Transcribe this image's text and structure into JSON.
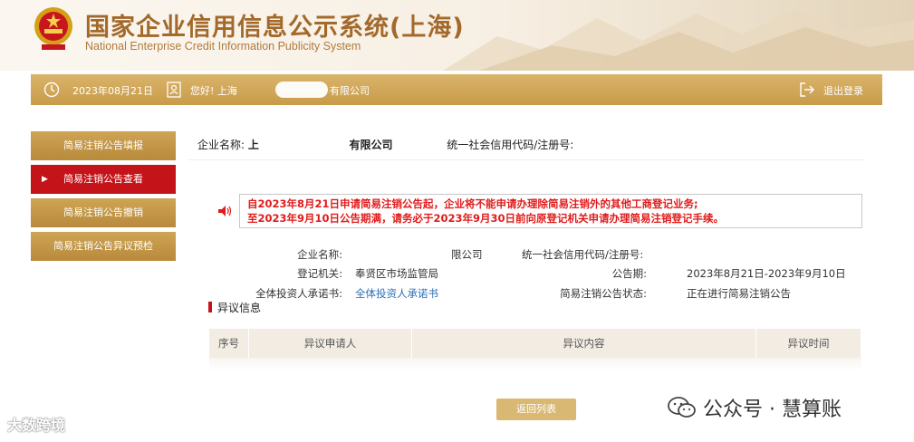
{
  "header": {
    "title": "国家企业信用信息公示系统(上海)",
    "subtitle": "National Enterprise Credit Information Publicity System",
    "brand_color": "#a3692b"
  },
  "infobar": {
    "date": "2023年08月21日",
    "greeting": "您好! 上海",
    "company_suffix": "有限公司",
    "logout_label": "退出登录",
    "icons": [
      "clock-icon",
      "user-icon",
      "logout-icon"
    ]
  },
  "sidebar": {
    "items": [
      {
        "label": "简易注销公告填报",
        "active": false
      },
      {
        "label": "简易注销公告查看",
        "active": true
      },
      {
        "label": "简易注销公告撤销",
        "active": false
      },
      {
        "label": "简易注销公告异议预检",
        "active": false
      }
    ],
    "active_color": "#c4141a"
  },
  "main": {
    "enterprise_name_label": "企业名称:",
    "enterprise_name_value_prefix": "上",
    "enterprise_name_value_suffix": "有限公司",
    "credit_code_label": "统一社会信用代码/注册号:",
    "notice_line1": "自2023年8月21日申请简易注销公告起，企业将不能申请办理除简易注销外的其他工商登记业务;",
    "notice_line2": "至2023年9月10日公告期满，请务必于2023年9月30日前向原登记机关申请办理简易注销登记手续。",
    "details": {
      "name_label": "企业名称:",
      "name_value": "限公司",
      "code_label": "统一社会信用代码/注册号:",
      "authority_label": "登记机关:",
      "authority_value": "奉贤区市场监管局",
      "period_label": "公告期:",
      "period_value": "2023年8月21日-2023年9月10日",
      "investor_label": "全体投资人承诺书:",
      "investor_link": "全体投资人承诺书",
      "status_label": "简易注销公告状态:",
      "status_value": "正在进行简易注销公告"
    },
    "objection_title": "异议信息",
    "table_headers": [
      "序号",
      "异议申请人",
      "异议内容",
      "异议时间"
    ],
    "back_button": "返回列表"
  },
  "watermarks": {
    "left": "大数跨境",
    "right": "公众号 · 慧算账"
  }
}
